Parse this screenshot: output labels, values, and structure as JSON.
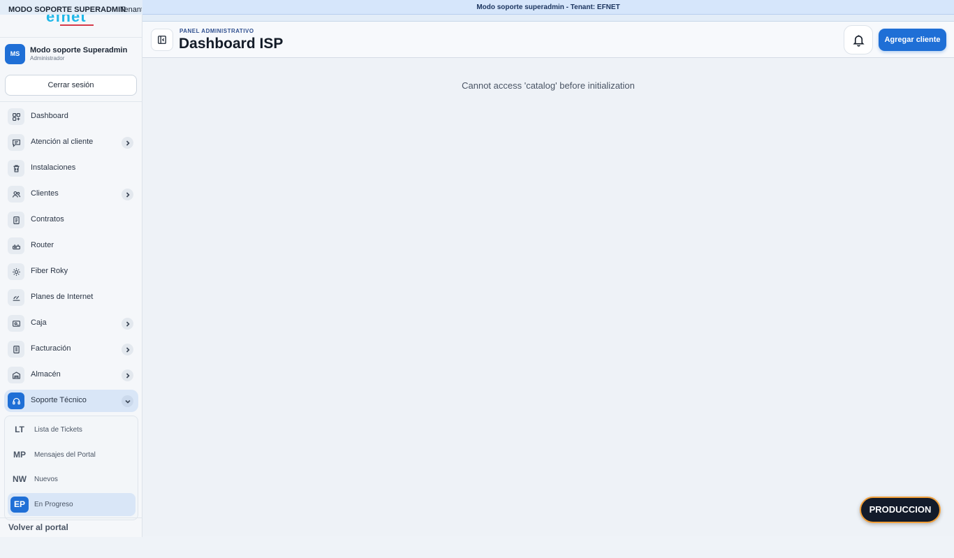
{
  "banner": {
    "left_label": "MODO SOPORTE SUPERADMIN",
    "left_tenant": "Tenant: EFNET",
    "center_text": "Modo soporte superadmin - Tenant: EFNET"
  },
  "sidebar": {
    "logo_text": "efnet",
    "user": {
      "initials": "MS",
      "name": "Modo soporte Superadmin",
      "role": "Administrador"
    },
    "logout_label": "Cerrar sesión",
    "items": [
      {
        "label": "Dashboard",
        "icon": "dashboard-grid-icon"
      },
      {
        "label": "Atención al cliente",
        "icon": "chat-icon",
        "expandable": true
      },
      {
        "label": "Instalaciones",
        "icon": "trash-can-icon"
      },
      {
        "label": "Clientes",
        "icon": "users-icon",
        "expandable": true
      },
      {
        "label": "Contratos",
        "icon": "document-icon"
      },
      {
        "label": "Router",
        "icon": "router-icon"
      },
      {
        "label": "Fiber Roky",
        "icon": "sun-icon"
      },
      {
        "label": "Planes de Internet",
        "icon": "speed-icon"
      },
      {
        "label": "Caja",
        "icon": "cash-register-icon",
        "expandable": true
      },
      {
        "label": "Facturación",
        "icon": "invoice-icon",
        "expandable": true
      },
      {
        "label": "Almacén",
        "icon": "warehouse-icon",
        "expandable": true
      },
      {
        "label": "Soporte Técnico",
        "icon": "headset-icon",
        "expandable": true,
        "expanded": true,
        "active": true
      }
    ],
    "submenu": [
      {
        "abbr": "LT",
        "label": "Lista de Tickets"
      },
      {
        "abbr": "MP",
        "label": "Mensajes del Portal"
      },
      {
        "abbr": "NW",
        "label": "Nuevos"
      },
      {
        "abbr": "EP",
        "label": "En Progreso",
        "active": true
      }
    ],
    "back_label": "Volver al portal"
  },
  "header": {
    "eyebrow": "PANEL ADMINISTRATIVO",
    "title": "Dashboard ISP",
    "add_client_label": "Agregar cliente"
  },
  "main": {
    "error_message": "Cannot access 'catalog' before initialization"
  },
  "env_badge": "PRODUCCION",
  "colors": {
    "accent": "#1f6fd6",
    "banner_bg": "#d6e6fb",
    "badge_border": "#f2a03a",
    "badge_bg": "#131b2a"
  }
}
